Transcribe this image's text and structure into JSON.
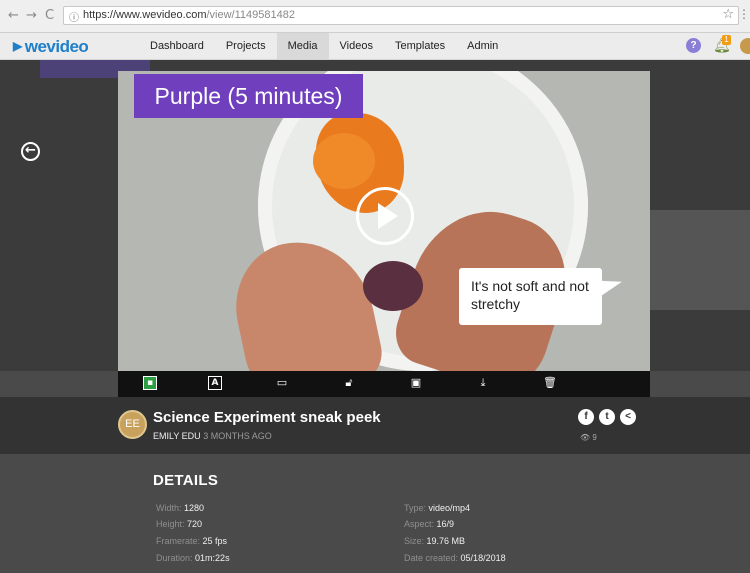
{
  "browser": {
    "back": "←",
    "forward": "→",
    "reload": "C",
    "url_host": "https://www.wevideo.com",
    "url_path": "/view/1149581482",
    "star": "☆"
  },
  "app": {
    "logo_text": "wevideo",
    "nav": [
      "Dashboard",
      "Projects",
      "Media",
      "Videos",
      "Templates",
      "Admin"
    ],
    "active_nav": "Media",
    "help_label": "?",
    "notification_count": "1"
  },
  "video": {
    "title_overlay": "Purple (5 minutes)",
    "caption": "It's not soft and not stretchy"
  },
  "toolbar": {
    "icons": [
      "thumbnail-icon",
      "text-icon",
      "screen-icon",
      "unlock-icon",
      "fit-icon",
      "download-icon",
      "trash-icon"
    ]
  },
  "info": {
    "avatar_initials": "EE",
    "title": "Science Experiment sneak peek",
    "author": "EMILY EDU",
    "ago": "3 MONTHS AGO",
    "views": "9"
  },
  "details": {
    "heading": "DETAILS",
    "left": [
      {
        "label": "Width:",
        "value": "1280"
      },
      {
        "label": "Height:",
        "value": "720"
      },
      {
        "label": "Framerate:",
        "value": "25 fps"
      },
      {
        "label": "Duration:",
        "value": "01m:22s"
      }
    ],
    "right": [
      {
        "label": "Type:",
        "value": "video/mp4"
      },
      {
        "label": "Aspect:",
        "value": "16/9"
      },
      {
        "label": "Size:",
        "value": "19.76 MB"
      },
      {
        "label": "Date created:",
        "value": "05/18/2018"
      }
    ]
  },
  "colors": {
    "brand": "#1f7fc9",
    "overlay_purple": "#6f3fbd",
    "accent_orange": "#f39c12"
  }
}
